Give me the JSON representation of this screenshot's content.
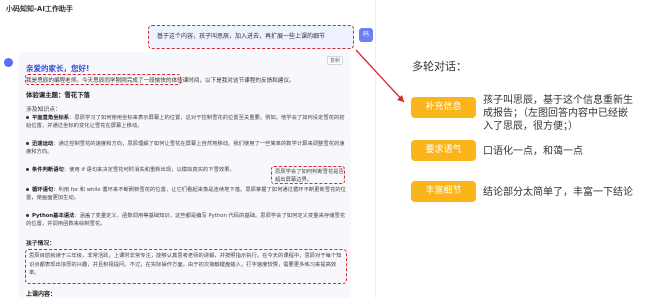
{
  "app": {
    "title": "小码知知-AI工作助手"
  },
  "user_message": {
    "text": "基于这个内容，孩子叫思辰，加入进去，再扩展一些上课的细节",
    "avatar": "码"
  },
  "reply": {
    "copy_label": "复制",
    "greeting": "亲爱的家长，您好!",
    "intro": "我是思辰的编程老师。今天思辰同学刚刚完成了一段愉快的体验课时间，以下是我对这节课程的反馈和建议。",
    "section1_title": "体验课主题：雪花下落",
    "section2_title": "涉及知识点：",
    "items": [
      {
        "term": "平面直角坐标系",
        "text": "：思辰学习了如何使用坐标来表示屏幕上的位置，这对于控制雪花的位置至关重要。例如，他学会了如何设定雪花的初始位置，并通过坐标的变化让雪花在屏幕上移动。"
      },
      {
        "term": "迅速运动",
        "text": "：通过控制雪花的速度和方向，思辰理解了如何让雪花在屏幕上自然地移动。我们使用了一些简单的数学计算来调整雪花的速度和方向。"
      },
      {
        "term": "条件判断语句",
        "text": "：使用 if 语句来决定雪花何时消失和重新出现，以模拟真实的下雪效果。"
      },
      {
        "term": "循环语句",
        "text": "：利用 for 和 while 循环来不断刷新雪花的位置，让它们看起来像是连续地下落。思辰掌握了如何通过循环不断更新雪花的位置，使画面更加生动。"
      },
      {
        "term": "Python基本语法",
        "text": "：涵盖了变量定义、函数调用等基础知识，这些都是编写 Python 代码的基础。思辰学会了如何定义变量来存储雪花的位置，并调用函数来绘制雪花。"
      }
    ],
    "inline_note": "思辰学会了如何判断雪花是否超出屏幕边界。",
    "section3_title": "孩子情况：",
    "child_situation": "思辰目前就读于三年级，非常活跃，上课时非常专注，能够认真思考老师的讲解，并按照指示执行。在今天的课程中，思辰对于每个知识点都表现出浓厚的兴趣，并且积极提问。不过，在实际操作方面，由于初次接触键盘输入，打字速度较慢，需要更多练习来提高效率。",
    "section4_title": "上课内容："
  },
  "panel": {
    "title": "多轮对话：",
    "rows": [
      {
        "tag": "补充信息",
        "desc": "孩子叫思辰，基于这个信息重新生成报告；（左图回答内容中已经嵌入了思辰，很方便；）"
      },
      {
        "tag": "要求语气",
        "desc": "口语化一点，和蔼一点"
      },
      {
        "tag": "丰富细节",
        "desc": "结论部分太简单了，丰富一下结论"
      }
    ]
  },
  "colors": {
    "accent": "#fbb51a",
    "annotation": "#d8262a",
    "brand": "#3a4cdc"
  }
}
